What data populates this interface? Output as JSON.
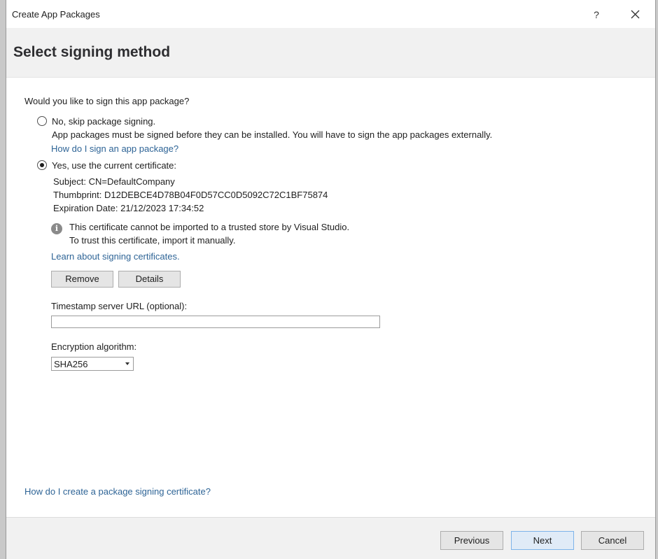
{
  "window": {
    "title": "Create App Packages",
    "help_label": "?"
  },
  "header": {
    "page_title": "Select signing method"
  },
  "main": {
    "question": "Would you like to sign this app package?",
    "option_skip": {
      "label": "No, skip package signing.",
      "selected": false,
      "description": "App packages must be signed before they can be installed. You will have to sign the app packages externally.",
      "link": "How do I sign an app package?"
    },
    "option_current": {
      "label": "Yes, use the current certificate:",
      "selected": true,
      "subject": "Subject: CN=DefaultCompany",
      "thumbprint": "Thumbprint: D12DEBCE4D78B04F0D57CC0D5092C72C1BF75874",
      "expiration": "Expiration Date: 21/12/2023 17:34:52",
      "info_line1": "This certificate cannot be imported to a trusted store by Visual Studio.",
      "info_line2": "To trust this certificate, import it manually.",
      "learn_link": "Learn about signing certificates.",
      "remove_label": "Remove",
      "details_label": "Details"
    },
    "timestamp": {
      "label": "Timestamp server URL (optional):",
      "value": "",
      "placeholder": ""
    },
    "encryption": {
      "label": "Encryption algorithm:",
      "selected": "SHA256"
    },
    "bottom_link": "How do I create a package signing certificate?"
  },
  "footer": {
    "previous_label": "Previous",
    "next_label": "Next",
    "cancel_label": "Cancel"
  },
  "colors": {
    "link": "#2e6496",
    "header_band": "#f1f1f1",
    "primary_button_border": "#7eb4ea"
  }
}
